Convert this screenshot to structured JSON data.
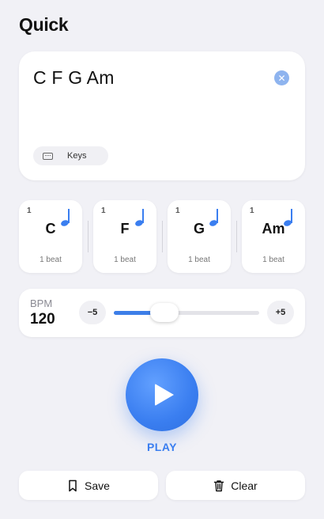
{
  "header": {
    "title": "Quick"
  },
  "input": {
    "text": "C F G Am",
    "clear_icon": "close-icon"
  },
  "keys_button": {
    "label": "Keys",
    "icon": "keyboard-icon"
  },
  "chords": [
    {
      "beat_index": "1",
      "name": "C",
      "duration": "1 beat"
    },
    {
      "beat_index": "1",
      "name": "F",
      "duration": "1 beat"
    },
    {
      "beat_index": "1",
      "name": "G",
      "duration": "1 beat"
    },
    {
      "beat_index": "1",
      "name": "Am",
      "duration": "1 beat"
    }
  ],
  "bpm": {
    "label": "BPM",
    "value": "120",
    "decrement_label": "−5",
    "increment_label": "+5",
    "slider_fraction": 0.35
  },
  "play": {
    "label": "PLAY",
    "icon": "play-icon"
  },
  "actions": {
    "save_label": "Save",
    "save_icon": "bookmark-icon",
    "clear_label": "Clear",
    "clear_icon": "trash-icon"
  },
  "colors": {
    "accent": "#3a7ef0",
    "background": "#f1f1f6",
    "card": "#ffffff",
    "clear_badge": "#8eb4ef"
  }
}
